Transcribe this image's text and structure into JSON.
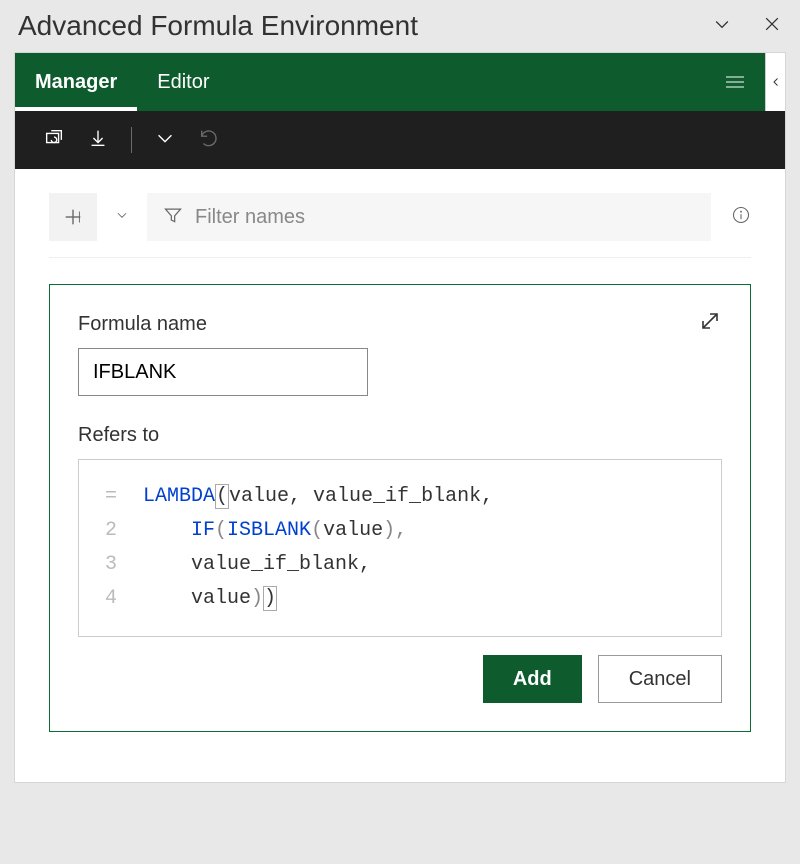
{
  "header": {
    "title": "Advanced Formula Environment"
  },
  "tabs": {
    "manager": "Manager",
    "editor": "Editor"
  },
  "filter": {
    "placeholder": "Filter names"
  },
  "formula": {
    "name_label": "Formula name",
    "name_value": "IFBLANK",
    "refers_label": "Refers to",
    "code_tokens": {
      "eq": "=",
      "lambda": "LAMBDA",
      "args": "value, value_if_blank,",
      "if": "IF",
      "isblank": "ISBLANK",
      "value": "value",
      "value_if_blank": "value_if_blank,",
      "close": "value"
    },
    "line2": "2",
    "line3": "3",
    "line4": "4"
  },
  "buttons": {
    "add": "Add",
    "cancel": "Cancel"
  }
}
